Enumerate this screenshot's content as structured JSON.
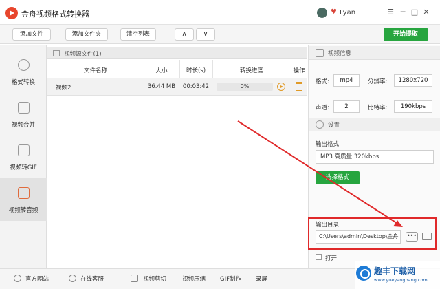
{
  "app": {
    "title": "金舟视频格式转换器",
    "user_name": "Lyan"
  },
  "window_controls": {
    "menu": "☰",
    "minimize": "─",
    "maximize": "□",
    "close": "✕"
  },
  "toolbar": {
    "add_file": "添加文件",
    "add_folder": "添加文件夹",
    "clear_list": "清空列表",
    "move_up": "∧",
    "move_down": "∨",
    "start": "开始提取"
  },
  "sidebar": {
    "items": [
      {
        "label": "格式转换",
        "icon": "play-circle-icon"
      },
      {
        "label": "视频合并",
        "icon": "merge-icon"
      },
      {
        "label": "视频转GIF",
        "icon": "image-icon"
      },
      {
        "label": "视频转音频",
        "icon": "music-note-icon",
        "active": true
      }
    ]
  },
  "file_panel": {
    "header": "视频源文件(1)",
    "columns": [
      "文件名称",
      "大小",
      "时长(s)",
      "转换进度",
      "操作"
    ],
    "rows": [
      {
        "name": "视频2",
        "size": "36.44 MB",
        "duration": "00:03:42",
        "progress": "0%"
      }
    ]
  },
  "video_info": {
    "title": "视频信息",
    "format_label": "格式:",
    "format_value": "mp4",
    "resolution_label": "分辨率:",
    "resolution_value": "1280x720",
    "channel_label": "声道:",
    "channel_value": "2",
    "bitrate_label": "比特率:",
    "bitrate_value": "190kbps"
  },
  "settings": {
    "title": "设置",
    "output_format_label": "输出格式",
    "output_format_value": "MP3 高质量 320kbps",
    "choose_format_button": "选择格式",
    "output_dir_label": "输出目录",
    "output_dir_value": "C:\\Users\\admin\\Desktop\\金舟",
    "more_button": "•••",
    "checkbox_label": "打开"
  },
  "bottom_bar": {
    "items": [
      "官方网站",
      "在线客服",
      "视频剪切",
      "视频压缩",
      "GIF制作",
      "录屏"
    ]
  },
  "watermark": {
    "title": "趣丰下载网",
    "url": "www.yueyangbang.com"
  },
  "colors": {
    "accent_green": "#27a53f",
    "highlight_red": "#e0292a",
    "brand_orange": "#e8462d"
  }
}
